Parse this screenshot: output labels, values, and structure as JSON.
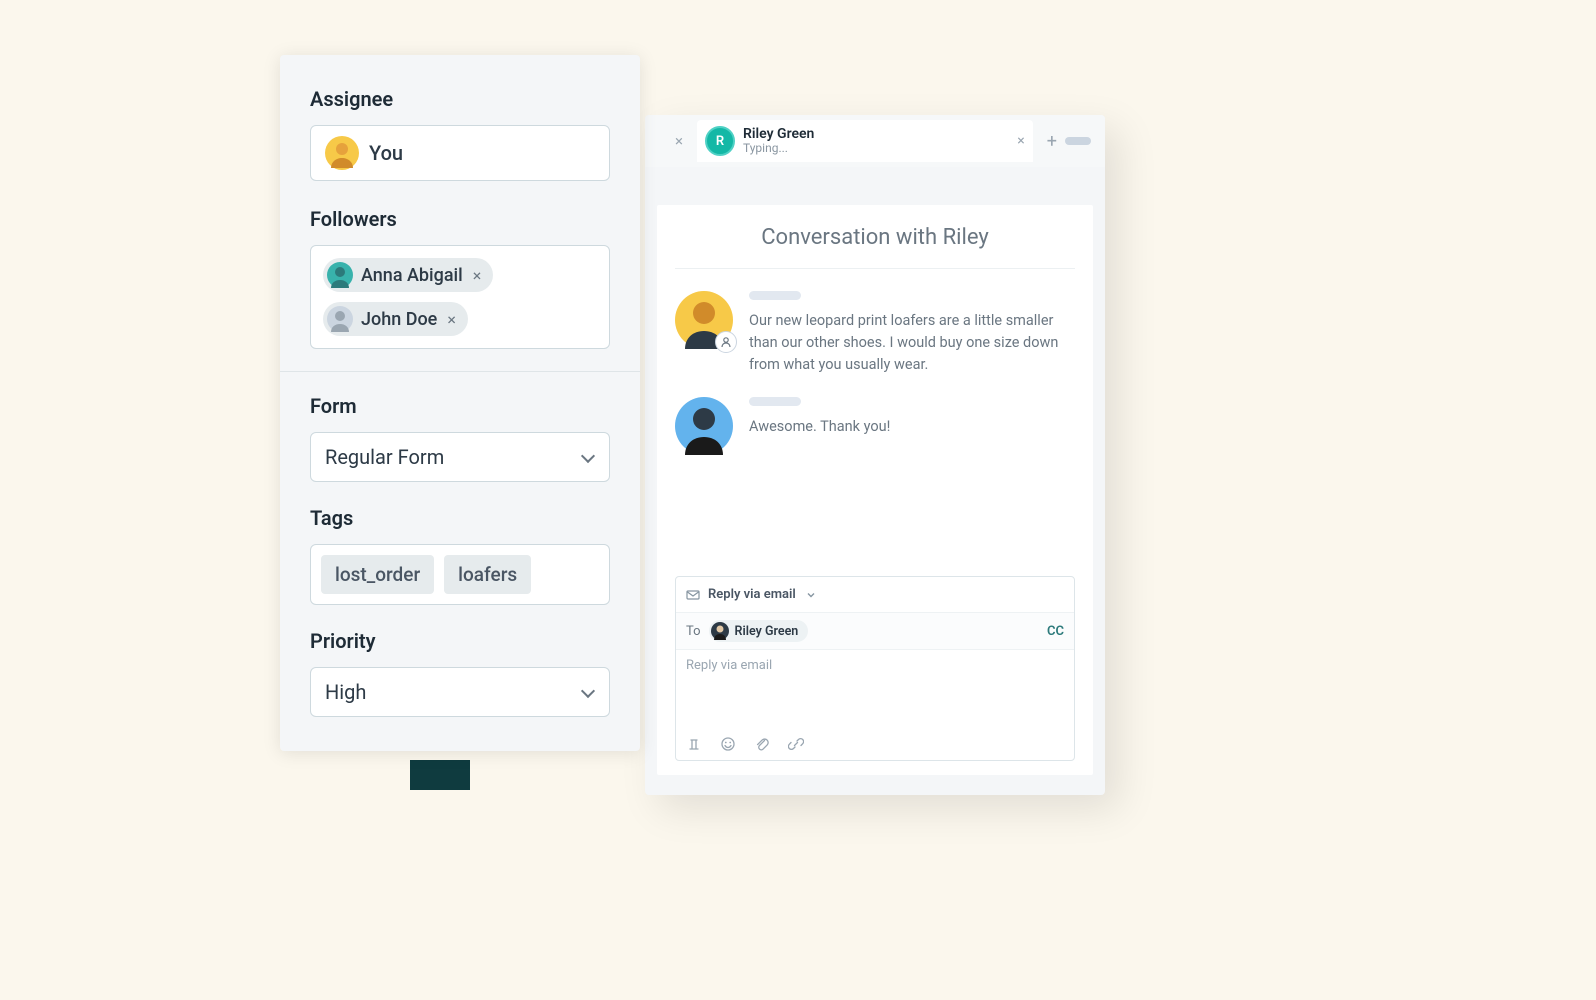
{
  "sidebar": {
    "assignee": {
      "label": "Assignee",
      "value": "You"
    },
    "followers": {
      "label": "Followers",
      "items": [
        {
          "name": "Anna Abigail"
        },
        {
          "name": "John Doe"
        }
      ]
    },
    "form": {
      "label": "Form",
      "value": "Regular Form"
    },
    "tags": {
      "label": "Tags",
      "items": [
        "lost_order",
        "loafers"
      ]
    },
    "priority": {
      "label": "Priority",
      "value": "High"
    }
  },
  "conversation": {
    "tab": {
      "name": "Riley Green",
      "status": "Typing...",
      "initial": "R"
    },
    "title": "Conversation with Riley",
    "messages": [
      {
        "text": "Our new leopard print loafers are a little smaller than our other shoes. I would buy one size down from what you usually wear."
      },
      {
        "text": "Awesome. Thank you!"
      }
    ],
    "composer": {
      "mode_label": "Reply via email",
      "to_label": "To",
      "to_name": "Riley Green",
      "cc_label": "CC",
      "placeholder": "Reply via email"
    }
  }
}
